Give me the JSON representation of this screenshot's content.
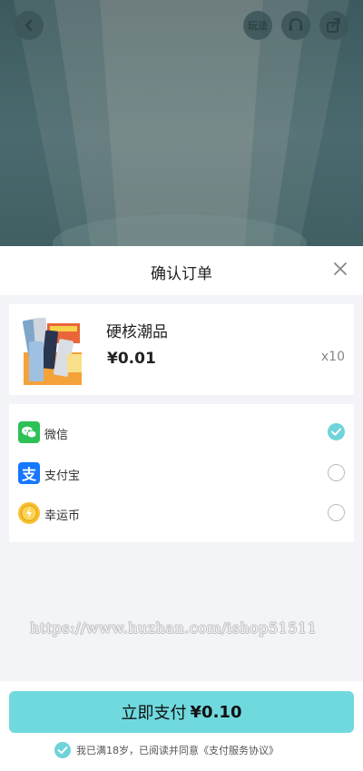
{
  "header": {
    "rules_label": "玩法"
  },
  "order": {
    "title": "确认订单"
  },
  "product": {
    "name": "硬核潮品",
    "price": "¥0.01",
    "quantity": "x10"
  },
  "payment_methods": [
    {
      "label": "微信",
      "icon": "wechat-pay-icon",
      "selected": true
    },
    {
      "label": "支付宝",
      "icon": "alipay-icon",
      "selected": false
    },
    {
      "label": "幸运币",
      "icon": "lucky-coin-icon",
      "selected": false
    }
  ],
  "watermark": "https://www.huzhan.com/ishop51511",
  "footer": {
    "pay_label": "立即支付",
    "pay_amount": "¥0.10",
    "agreement_text": "我已满18岁，已阅读并同意《支付服务协议》"
  },
  "colors": {
    "accent": "#6fd9de",
    "header_bg": "#4a6a6f"
  }
}
